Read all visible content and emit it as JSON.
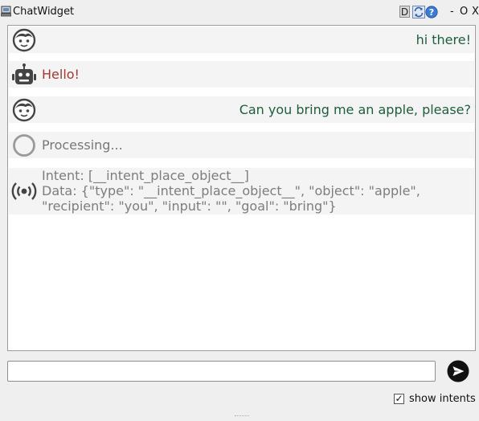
{
  "window": {
    "title": "ChatWidget",
    "debug_label": "D",
    "minimize_label": "-",
    "maximize_label": "O",
    "close_label": "X"
  },
  "messages": [
    {
      "sender": "user",
      "text": "hi there!"
    },
    {
      "sender": "bot",
      "text": "Hello!"
    },
    {
      "sender": "user",
      "text": "Can you bring me an apple, please?"
    },
    {
      "sender": "status",
      "text": "Processing..."
    },
    {
      "sender": "intent",
      "line1": "Intent: [__intent_place_object__]",
      "line2": "Data: {\"type\": \"__intent_place_object__\", \"object\": \"apple\",",
      "line3": "\"recipient\": \"you\", \"input\": \"\", \"goal\": \"bring\"}"
    }
  ],
  "input": {
    "value": "",
    "placeholder": ""
  },
  "options": {
    "show_intents_label": "show intents",
    "show_intents_checked": true,
    "check_mark": "✓"
  },
  "colors": {
    "user_text": "#1f5e3b",
    "bot_text": "#a33a32",
    "muted_text": "#777777",
    "message_bg": "#f4f4f4"
  }
}
